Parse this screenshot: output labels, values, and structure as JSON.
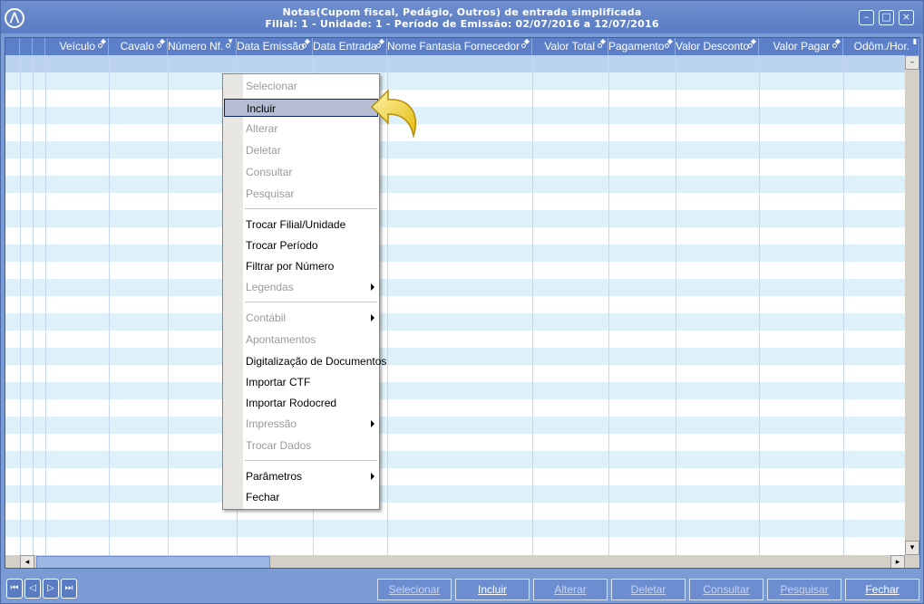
{
  "window": {
    "title_line1": "Notas(Cupom fiscal, Pedágio, Outros) de entrada simplificada",
    "title_line2": "Filial: 1 - Unidade: 1 - Período de Emissão: 02/07/2016 a 12/07/2016",
    "min_glyph": "–",
    "max_glyph": "□",
    "close_glyph": "×",
    "logo_glyph": "⋀"
  },
  "grid": {
    "columns": [
      "Veículo",
      "Cavalo",
      "Número Nf.",
      "Data Emissão",
      "Data Entrada",
      "Nome Fantasia Fornecedor",
      "Valor Total",
      "Pagamento",
      "Valor Desconto",
      "Valor Pagar",
      "Odôm./Hor."
    ],
    "scroll_up_glyph": "–",
    "scroll_down_glyph": "▾",
    "scroll_left_glyph": "◂",
    "scroll_right_glyph": "▸"
  },
  "context_menu": {
    "items": [
      {
        "label": "Selecionar",
        "state": "disabled"
      },
      {
        "label": "Incluir",
        "state": "hover"
      },
      {
        "label": "Alterar",
        "state": "disabled"
      },
      {
        "label": "Deletar",
        "state": "disabled"
      },
      {
        "label": "Consultar",
        "state": "disabled"
      },
      {
        "label": "Pesquisar",
        "state": "disabled"
      },
      {
        "label": "Trocar Filial/Unidade",
        "state": "enabled"
      },
      {
        "label": "Trocar Período",
        "state": "enabled"
      },
      {
        "label": "Filtrar por Número",
        "state": "enabled"
      },
      {
        "label": "Legendas",
        "state": "disabled",
        "submenu": true
      },
      {
        "label": "Contábil",
        "state": "disabled",
        "submenu": true
      },
      {
        "label": "Apontamentos",
        "state": "disabled"
      },
      {
        "label": "Digitalização de Documentos",
        "state": "enabled"
      },
      {
        "label": "Importar CTF",
        "state": "enabled"
      },
      {
        "label": "Importar Rodocred",
        "state": "enabled"
      },
      {
        "label": "Impressão",
        "state": "disabled",
        "submenu": true
      },
      {
        "label": "Trocar Dados",
        "state": "disabled"
      },
      {
        "label": "Parâmetros",
        "state": "enabled",
        "submenu": true
      },
      {
        "label": "Fechar",
        "state": "enabled"
      }
    ]
  },
  "navigation": {
    "first_glyph": "⏮",
    "prev_glyph": "◁",
    "next_glyph": "▷",
    "last_glyph": "⏭"
  },
  "actions": {
    "selecionar": "Selecionar",
    "incluir": "Incluir",
    "alterar": "Alterar",
    "deletar": "Deletar",
    "consultar": "Consultar",
    "pesquisar": "Pesquisar",
    "fechar": "Fechar"
  },
  "colors": {
    "window_bg": "#7b9bd4",
    "header_bg": "#5b7fc8",
    "row_alt": "#def1fb",
    "menu_hover": "#b6bdd2"
  }
}
